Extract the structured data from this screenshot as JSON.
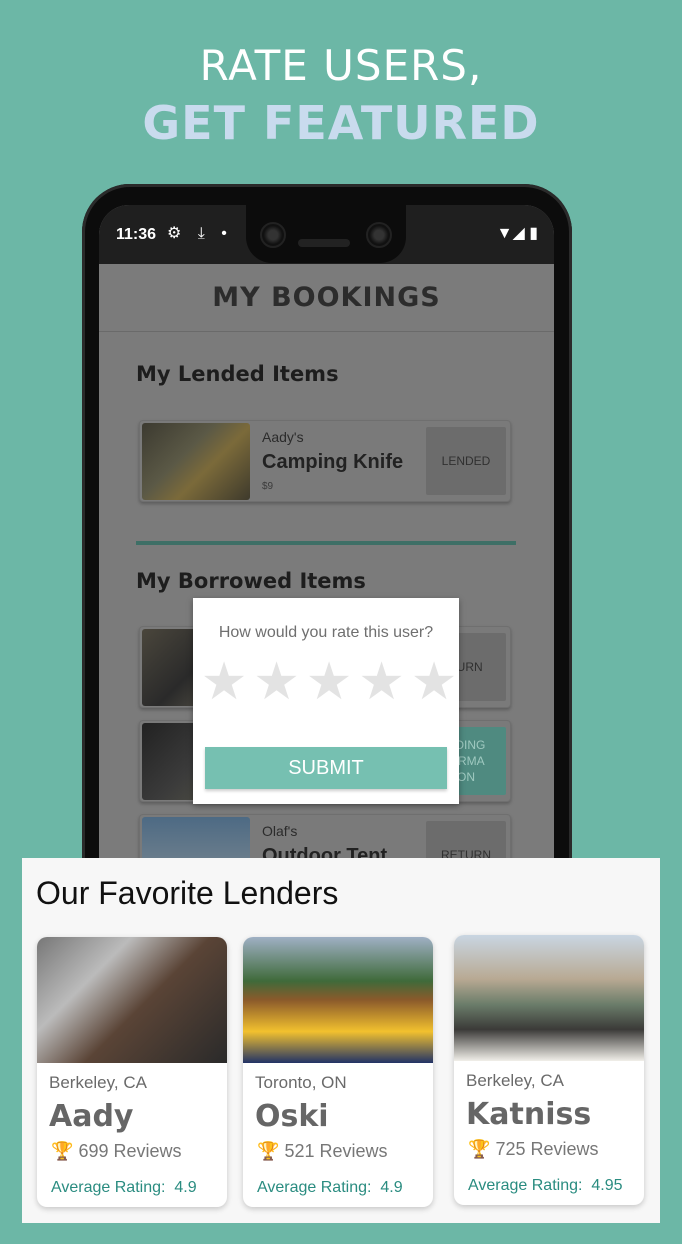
{
  "headline": {
    "line1": "RATE USERS,",
    "line2": "GET FEATURED"
  },
  "status": {
    "time": "11:36",
    "left_icons": "⚙ ⤓ •",
    "right_icons": "▼◢ ▮"
  },
  "app": {
    "title": "MY BOOKINGS",
    "lended_title": "My Lended Items",
    "borrowed_title": "My Borrowed Items"
  },
  "lended": [
    {
      "owner": "Aady's",
      "item": "Camping Knife",
      "price": "$9",
      "action": "LENDED"
    }
  ],
  "borrowed": [
    {
      "action": "TURN"
    },
    {
      "action": "NDING\nFIRMA\nON"
    },
    {
      "owner": "Olaf's",
      "item": "Outdoor Tent",
      "action": "RETURN"
    }
  ],
  "modal": {
    "question": "How would you rate this user?",
    "submit": "SUBMIT",
    "star_count": 5
  },
  "favorites": {
    "title": "Our Favorite Lenders",
    "lenders": [
      {
        "city": "Berkeley, CA",
        "name": "Aady",
        "reviews": "699 Reviews",
        "rating_label": "Average Rating:",
        "rating": "4.9"
      },
      {
        "city": "Toronto, ON",
        "name": "Oski",
        "reviews": "521 Reviews",
        "rating_label": "Average Rating:",
        "rating": "4.9"
      },
      {
        "city": "Berkeley, CA",
        "name": "Katniss",
        "reviews": "725 Reviews",
        "rating_label": "Average Rating:",
        "rating": "4.95"
      }
    ]
  },
  "colors": {
    "background": "#6cb7a6",
    "accent": "#76c0b1",
    "rating_text": "#2a8c80"
  }
}
